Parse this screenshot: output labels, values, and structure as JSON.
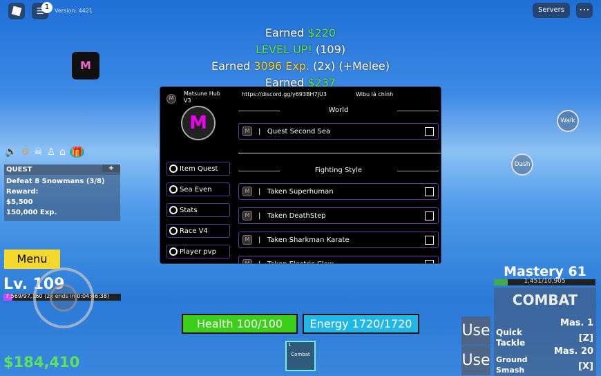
{
  "topbar": {
    "version": "Version: 4421",
    "notif_count": "1",
    "servers": "Servers",
    "more": "⋯"
  },
  "notifications": [
    {
      "prefix": "Earned ",
      "highlight": "$220",
      "suffix": ""
    },
    {
      "prefix": "",
      "highlight": "LEVEL UP!",
      "suffix": " (109)"
    },
    {
      "prefix": "Earned ",
      "highlight": "3096 Exp.",
      "suffix": " (2x) (+Melee)"
    },
    {
      "prefix": "Earned ",
      "highlight": "$237",
      "suffix": ""
    }
  ],
  "hub": {
    "title": "Matsune Hub V3",
    "discord": "https://discord.gg/y693BH7JU3",
    "tagline": "Wibu là chính",
    "nav": [
      "Item Quest",
      "Sea Even",
      "Stats",
      "Race V4",
      "Player pvp"
    ],
    "sections": [
      {
        "title": "World",
        "items": [
          "Quest Second Sea"
        ]
      },
      {
        "title": "Fighting Style",
        "items": [
          "Taken Superhuman",
          "Taken DeathStep",
          "Taken Sharkman Karate",
          "Taken Electric Claw"
        ]
      }
    ]
  },
  "quest": {
    "header": "QUEST",
    "plus": "+",
    "task": "Defeat 8 Snowmans (3/8)",
    "reward_label": "Reward:",
    "money": "$5,500",
    "exp": "150,000 Exp."
  },
  "menu": "Menu",
  "level": "Lv. 109",
  "xp": "7,569/97,160 (2x ends in 0:04:46:38)",
  "xp_progress": 0.078,
  "money": "$184,410",
  "health": "Health 100/100",
  "energy": "Energy 1720/1720",
  "hotbar": {
    "slot": "1",
    "item": "Combat"
  },
  "buttons": {
    "walk": "Walk",
    "dash": "Dash"
  },
  "mastery": {
    "title": "Mastery 61",
    "progress_text": "1,451/10,905",
    "progress": 0.133,
    "weapon": "COMBAT",
    "skills": [
      {
        "use": "Use",
        "name": "Quick Tackle",
        "mas": "Mas. 1",
        "key": "[Z]"
      },
      {
        "use": "Use",
        "name": "Ground Smash",
        "mas": "Mas. 20",
        "key": "[X]"
      }
    ]
  }
}
